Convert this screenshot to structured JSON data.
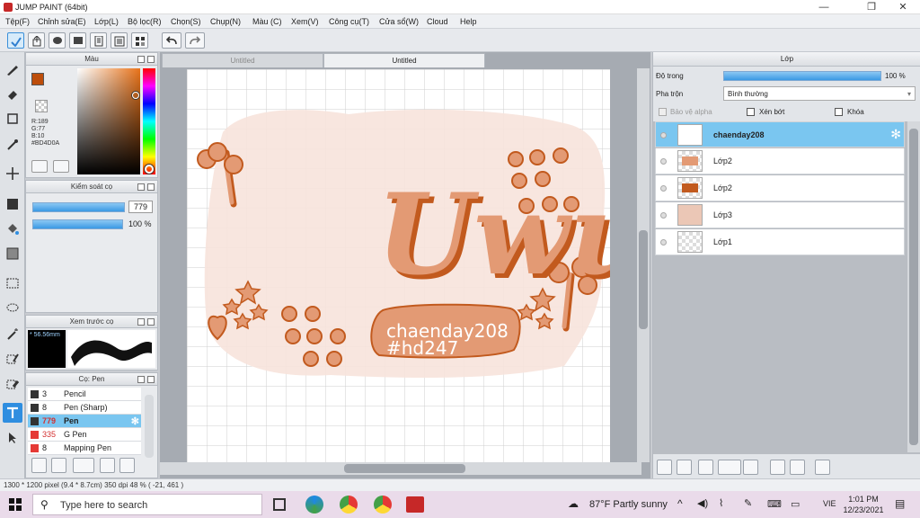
{
  "window": {
    "title": "JUMP PAINT (64bit)",
    "min": "—",
    "max": "❐",
    "close": "✕"
  },
  "menu": [
    "Tệp(F)",
    "Chỉnh sửa(E)",
    "Lớp(L)",
    "Bộ lọc(R)",
    "Chọn(S)",
    "Chụp(N)",
    "Màu (C)",
    "Xem(V)",
    "Công cụ(T)",
    "Cửa sổ(W)",
    "Cloud",
    "Help"
  ],
  "color_panel": {
    "title": "Màu",
    "r": "R:189",
    "g": "G:77",
    "b": "B:10",
    "hex": "#BD4D0A",
    "primary": "#BD4D0A",
    "secondary": "#E8A07A"
  },
  "brush_control": {
    "title": "Kiểm soát cọ",
    "size": "779",
    "opacity": "100 %",
    "opacity_level": 1.0
  },
  "preview": {
    "title": "Xem trước cọ",
    "size": "* 56.56mm"
  },
  "brush_list": {
    "title": "Cọ: Pen",
    "items": [
      {
        "size": "3",
        "name": "Pencil",
        "color": "#333333"
      },
      {
        "size": "8",
        "name": "Pen (Sharp)",
        "color": "#333333"
      },
      {
        "size": "779",
        "name": "Pen",
        "color": "#333333"
      },
      {
        "size": "335",
        "name": "G Pen",
        "color": "#e53935"
      },
      {
        "size": "8",
        "name": "Mapping Pen",
        "color": "#e53935"
      }
    ]
  },
  "doc_tabs": [
    "Untitled",
    "Untitled"
  ],
  "artwork": {
    "main_text": "Uwu",
    "line1": "chaenday208",
    "line2": "#hd247",
    "accent": "#E39A74",
    "shadow": "#C25A1E",
    "bg": "#F7E4DC"
  },
  "layers_panel": {
    "title": "Lớp",
    "opacity_label": "Độ trong",
    "opacity_value": "100 %",
    "opacity_level": 1.0,
    "blend_label": "Pha trộn",
    "blend_value": "Bình thường",
    "protect_alpha": "Bảo vệ alpha",
    "clipping": "Xén bớt",
    "lock": "Khóa",
    "layers": [
      {
        "name": "chaenday208",
        "selected": true
      },
      {
        "name": "Lớp2",
        "selected": false
      },
      {
        "name": "Lớp2",
        "selected": false
      },
      {
        "name": "Lớp3",
        "selected": false
      },
      {
        "name": "Lớp1",
        "selected": false
      }
    ]
  },
  "status": "1300 * 1200 pixel  (9.4 * 8.7cm)  350 dpi  48 %  ( -21, 461 )",
  "taskbar": {
    "search_placeholder": "Type here to search",
    "weather": "87°F  Partly sunny",
    "lang": "VIE",
    "time": "1:01 PM",
    "date": "12/23/2021"
  }
}
